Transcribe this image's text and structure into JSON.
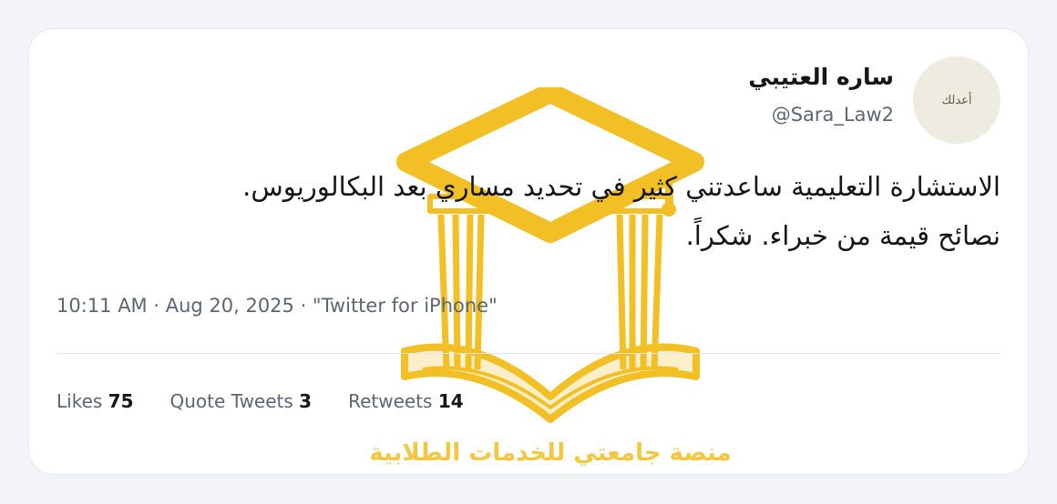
{
  "tweet": {
    "display_name": "ساره العتيبي",
    "handle": "@Sara_Law2",
    "avatar_text": "أعدلك",
    "text_lines": [
      "الاستشارة التعليمية ساعدتني كثير في تحديد مساري بعد البكالوريوس.",
      "نصائح قيمة من خبراء. شكراً."
    ],
    "meta": "10:11 AM · Aug 20, 2025 · \"Twitter for iPhone\"",
    "stats": {
      "likes_label": "Likes",
      "likes_count": "75",
      "quotes_label": "Quote Tweets",
      "quotes_count": "3",
      "retweets_label": "Retweets",
      "retweets_count": "14"
    }
  },
  "watermark": {
    "text": "منصة جامعتي للخدمات الطلابية",
    "color": "#f0b400"
  },
  "colors": {
    "background": "#f3f4f7",
    "card": "#ffffff",
    "text_primary": "#141619",
    "text_secondary": "#5c6673"
  }
}
